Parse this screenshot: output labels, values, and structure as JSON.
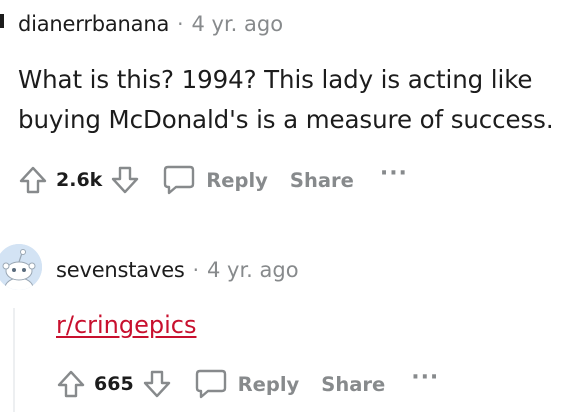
{
  "comments": [
    {
      "author": "dianerrbanana",
      "separator": "·",
      "timestamp": "4 yr. ago",
      "body": "What is this? 1994? This lady is acting like buying McDonald's is a measure of success.",
      "score": "2.6k",
      "actions": {
        "reply": "Reply",
        "share": "Share",
        "more": "···"
      }
    },
    {
      "author": "sevenstaves",
      "separator": "·",
      "timestamp": "4 yr. ago",
      "link_text": "r/cringepics",
      "score": "665",
      "actions": {
        "reply": "Reply",
        "share": "Share",
        "more": "···"
      }
    }
  ],
  "icons": {
    "upvote": "upvote-icon",
    "downvote": "downvote-icon",
    "reply": "chat-bubble-icon",
    "avatar": "snoo-avatar-icon"
  },
  "colors": {
    "muted": "#878a8c",
    "link": "#c8102e",
    "text": "#1c1c1c",
    "avatar_bg": "#d3e3f4"
  }
}
